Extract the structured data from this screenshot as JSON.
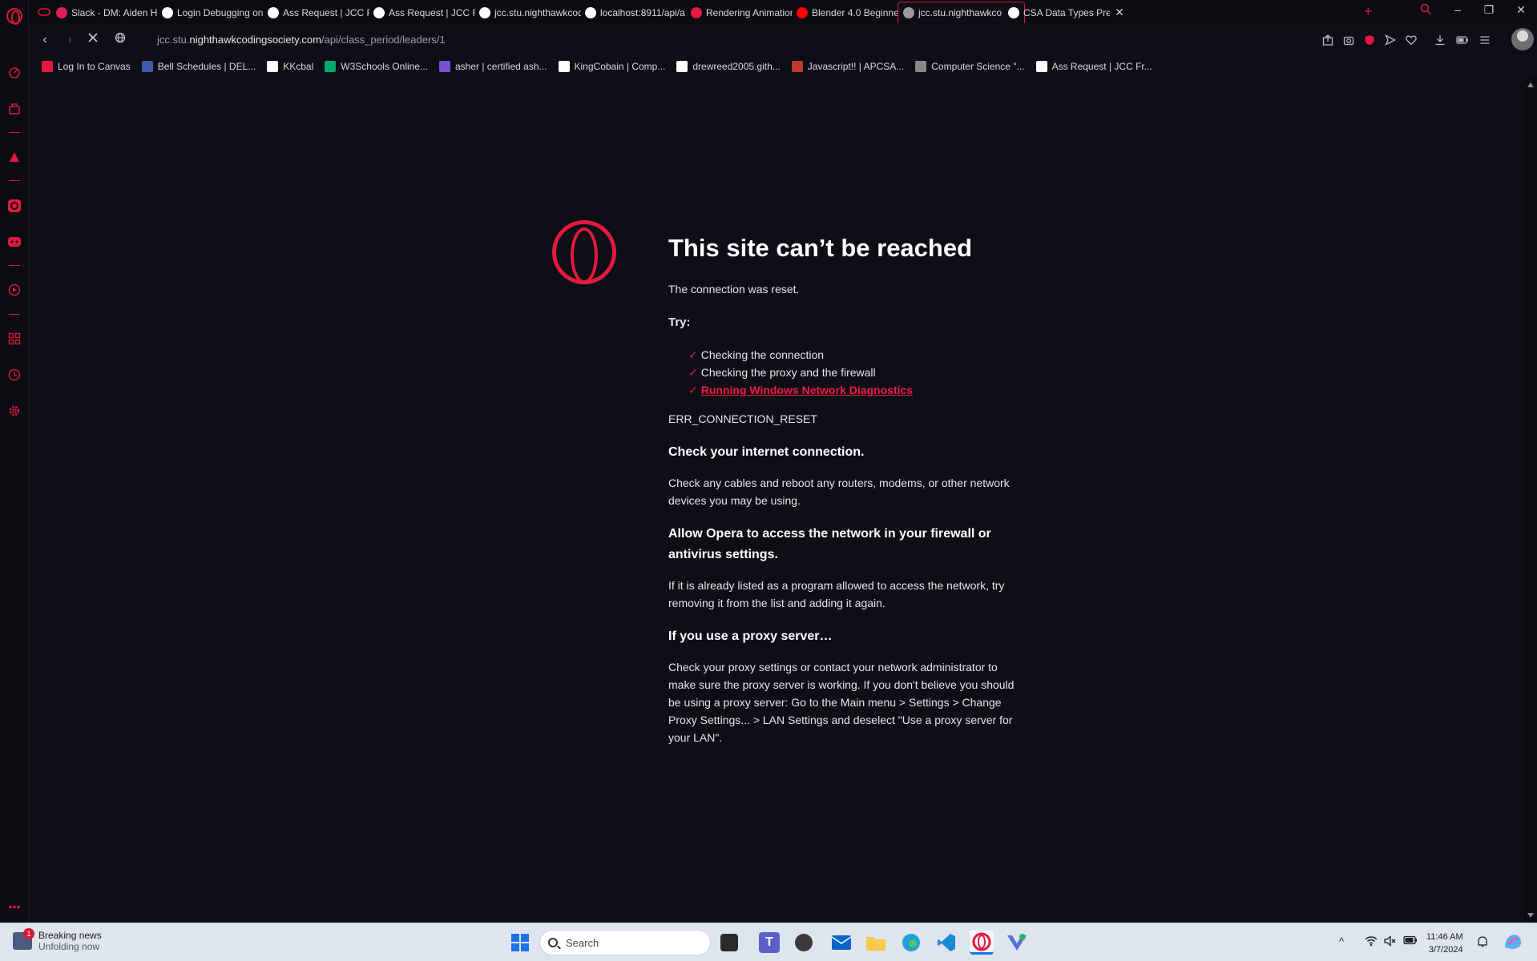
{
  "tabs": [
    {
      "title": "Slack - DM: Aiden H",
      "favicon_color": "#e01e5a"
    },
    {
      "title": "Login Debugging on",
      "favicon_color": "#ffffff"
    },
    {
      "title": "Ass Request | JCC Fr",
      "favicon_color": "#ffffff"
    },
    {
      "title": "Ass Request | JCC Fr",
      "favicon_color": "#ffffff"
    },
    {
      "title": "jcc.stu.nighthawkcod",
      "favicon_color": "#ffffff"
    },
    {
      "title": "localhost:8911/api/a",
      "favicon_color": "#ffffff"
    },
    {
      "title": "Rendering Animation",
      "favicon_color": "#e5193f"
    },
    {
      "title": "Blender 4.0 Beginne",
      "favicon_color": "#ff0000"
    },
    {
      "title": "jcc.stu.nighthawkco",
      "favicon_color": "#9a9aa4"
    },
    {
      "title": "CSA Data Types Prep",
      "favicon_color": "#ffffff"
    }
  ],
  "address": {
    "prefix": "jcc.stu.",
    "host": "nighthawkcodingsociety.com",
    "path": "/api/class_period/leaders/1"
  },
  "bookmarks": [
    {
      "label": "Log In to Canvas",
      "color": "#e5193f"
    },
    {
      "label": "Bell Schedules | DEL...",
      "color": "#3f5aa8"
    },
    {
      "label": "KKcbal",
      "color": "#ffffff"
    },
    {
      "label": "W3Schools Online...",
      "color": "#04aa6d"
    },
    {
      "label": "asher | certified ash...",
      "color": "#7a4fd6"
    },
    {
      "label": "KingCobain | Comp...",
      "color": "#ffffff"
    },
    {
      "label": "drewreed2005.gith...",
      "color": "#ffffff"
    },
    {
      "label": "Javascript!! | APCSA...",
      "color": "#c0392b"
    },
    {
      "label": "Computer Science \"...",
      "color": "#888888"
    },
    {
      "label": "Ass Request | JCC Fr...",
      "color": "#ffffff"
    }
  ],
  "error": {
    "title": "This site can’t be reached",
    "subtitle": "The connection was reset.",
    "try_label": "Try:",
    "suggestions": [
      {
        "text": "Checking the connection",
        "link": false
      },
      {
        "text": "Checking the proxy and the firewall",
        "link": false
      },
      {
        "text": "Running Windows Network Diagnostics",
        "link": true
      }
    ],
    "code": "ERR_CONNECTION_RESET",
    "sections": [
      {
        "heading": "Check your internet connection.",
        "body": "Check any cables and reboot any routers, modems, or other network devices you may be using."
      },
      {
        "heading": "Allow Opera to access the network in your firewall or antivirus settings.",
        "body": "If it is already listed as a program allowed to access the network, try removing it from the list and adding it again."
      },
      {
        "heading": "If you use a proxy server…",
        "body": "Check your proxy settings or contact your network administrator to make sure the proxy server is working. If you don't believe you should be using a proxy server: Go to the Main menu > Settings > Change Proxy Settings... > LAN Settings and deselect \"Use a proxy server for your LAN\"."
      }
    ]
  },
  "taskbar": {
    "news_title": "Breaking news",
    "news_sub": "Unfolding now",
    "news_badge": "1",
    "search_placeholder": "Search",
    "time": "11:46 AM",
    "date": "3/7/2024"
  },
  "colors": {
    "accent": "#e5193f",
    "background": "#0e0e17",
    "taskbar": "#dfe5ee"
  }
}
